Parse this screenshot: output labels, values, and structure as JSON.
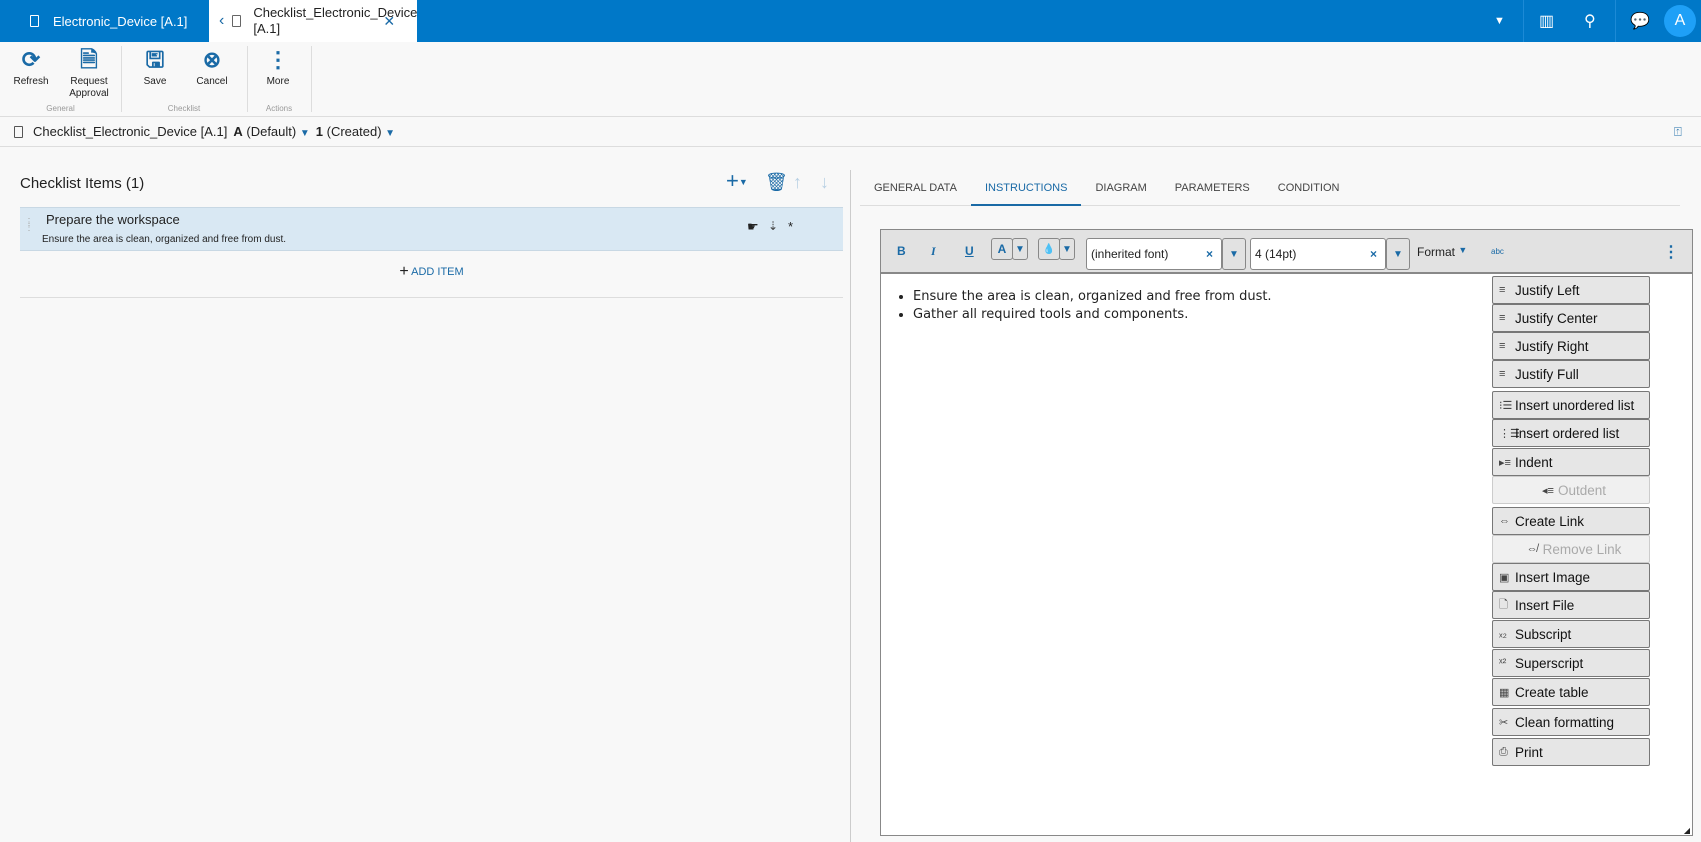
{
  "tabs": [
    {
      "label": "Electronic_Device [A.1]"
    },
    {
      "label": "Checklist_Electronic_Device [A.1]"
    }
  ],
  "header": {
    "avatar": "A"
  },
  "ribbon": {
    "groups": [
      {
        "label": "General"
      },
      {
        "label": "Checklist"
      },
      {
        "label": "Actions"
      }
    ],
    "buttons": [
      {
        "label": "Refresh"
      },
      {
        "label": "Request Approval"
      },
      {
        "label": "Save"
      },
      {
        "label": "Cancel"
      },
      {
        "label": "More"
      }
    ]
  },
  "breadcrumb": {
    "title": "Checklist_Electronic_Device [A.1]",
    "rev_letter": "A",
    "rev_label": "(Default)",
    "ver_num": "1",
    "ver_label": "(Created)"
  },
  "checklist": {
    "title": "Checklist Items (1)",
    "items": [
      {
        "title": "Prepare the workspace",
        "description": "Ensure the area is clean, organized and free from dust."
      }
    ],
    "add_label": "ADD ITEM"
  },
  "right_tabs": [
    {
      "label": "GENERAL DATA"
    },
    {
      "label": "INSTRUCTIONS"
    },
    {
      "label": "DIAGRAM"
    },
    {
      "label": "PARAMETERS"
    },
    {
      "label": "CONDITION"
    }
  ],
  "editor": {
    "bold": "B",
    "italic": "I",
    "underline": "U",
    "font_color": "A",
    "font": "(inherited font)",
    "size": "4 (14pt)",
    "format": "Format",
    "spell": "abc",
    "content": [
      "Ensure the area is clean, organized and free from dust.",
      "Gather all required tools and components."
    ],
    "menu": [
      {
        "label": "Justify Left"
      },
      {
        "label": "Justify Center"
      },
      {
        "label": "Justify Right"
      },
      {
        "label": "Justify Full"
      },
      {
        "label": "Insert unordered list"
      },
      {
        "label": "Insert ordered list"
      },
      {
        "label": "Indent"
      },
      {
        "label": "Outdent"
      },
      {
        "label": "Create Link"
      },
      {
        "label": "Remove Link"
      },
      {
        "label": "Insert Image"
      },
      {
        "label": "Insert File"
      },
      {
        "label": "Subscript"
      },
      {
        "label": "Superscript"
      },
      {
        "label": "Create table"
      },
      {
        "label": "Clean formatting"
      },
      {
        "label": "Print"
      }
    ]
  },
  "colors": {
    "brand": "#0078c8",
    "accent": "#1a6aa6",
    "selected_row": "#d9e8f3"
  }
}
